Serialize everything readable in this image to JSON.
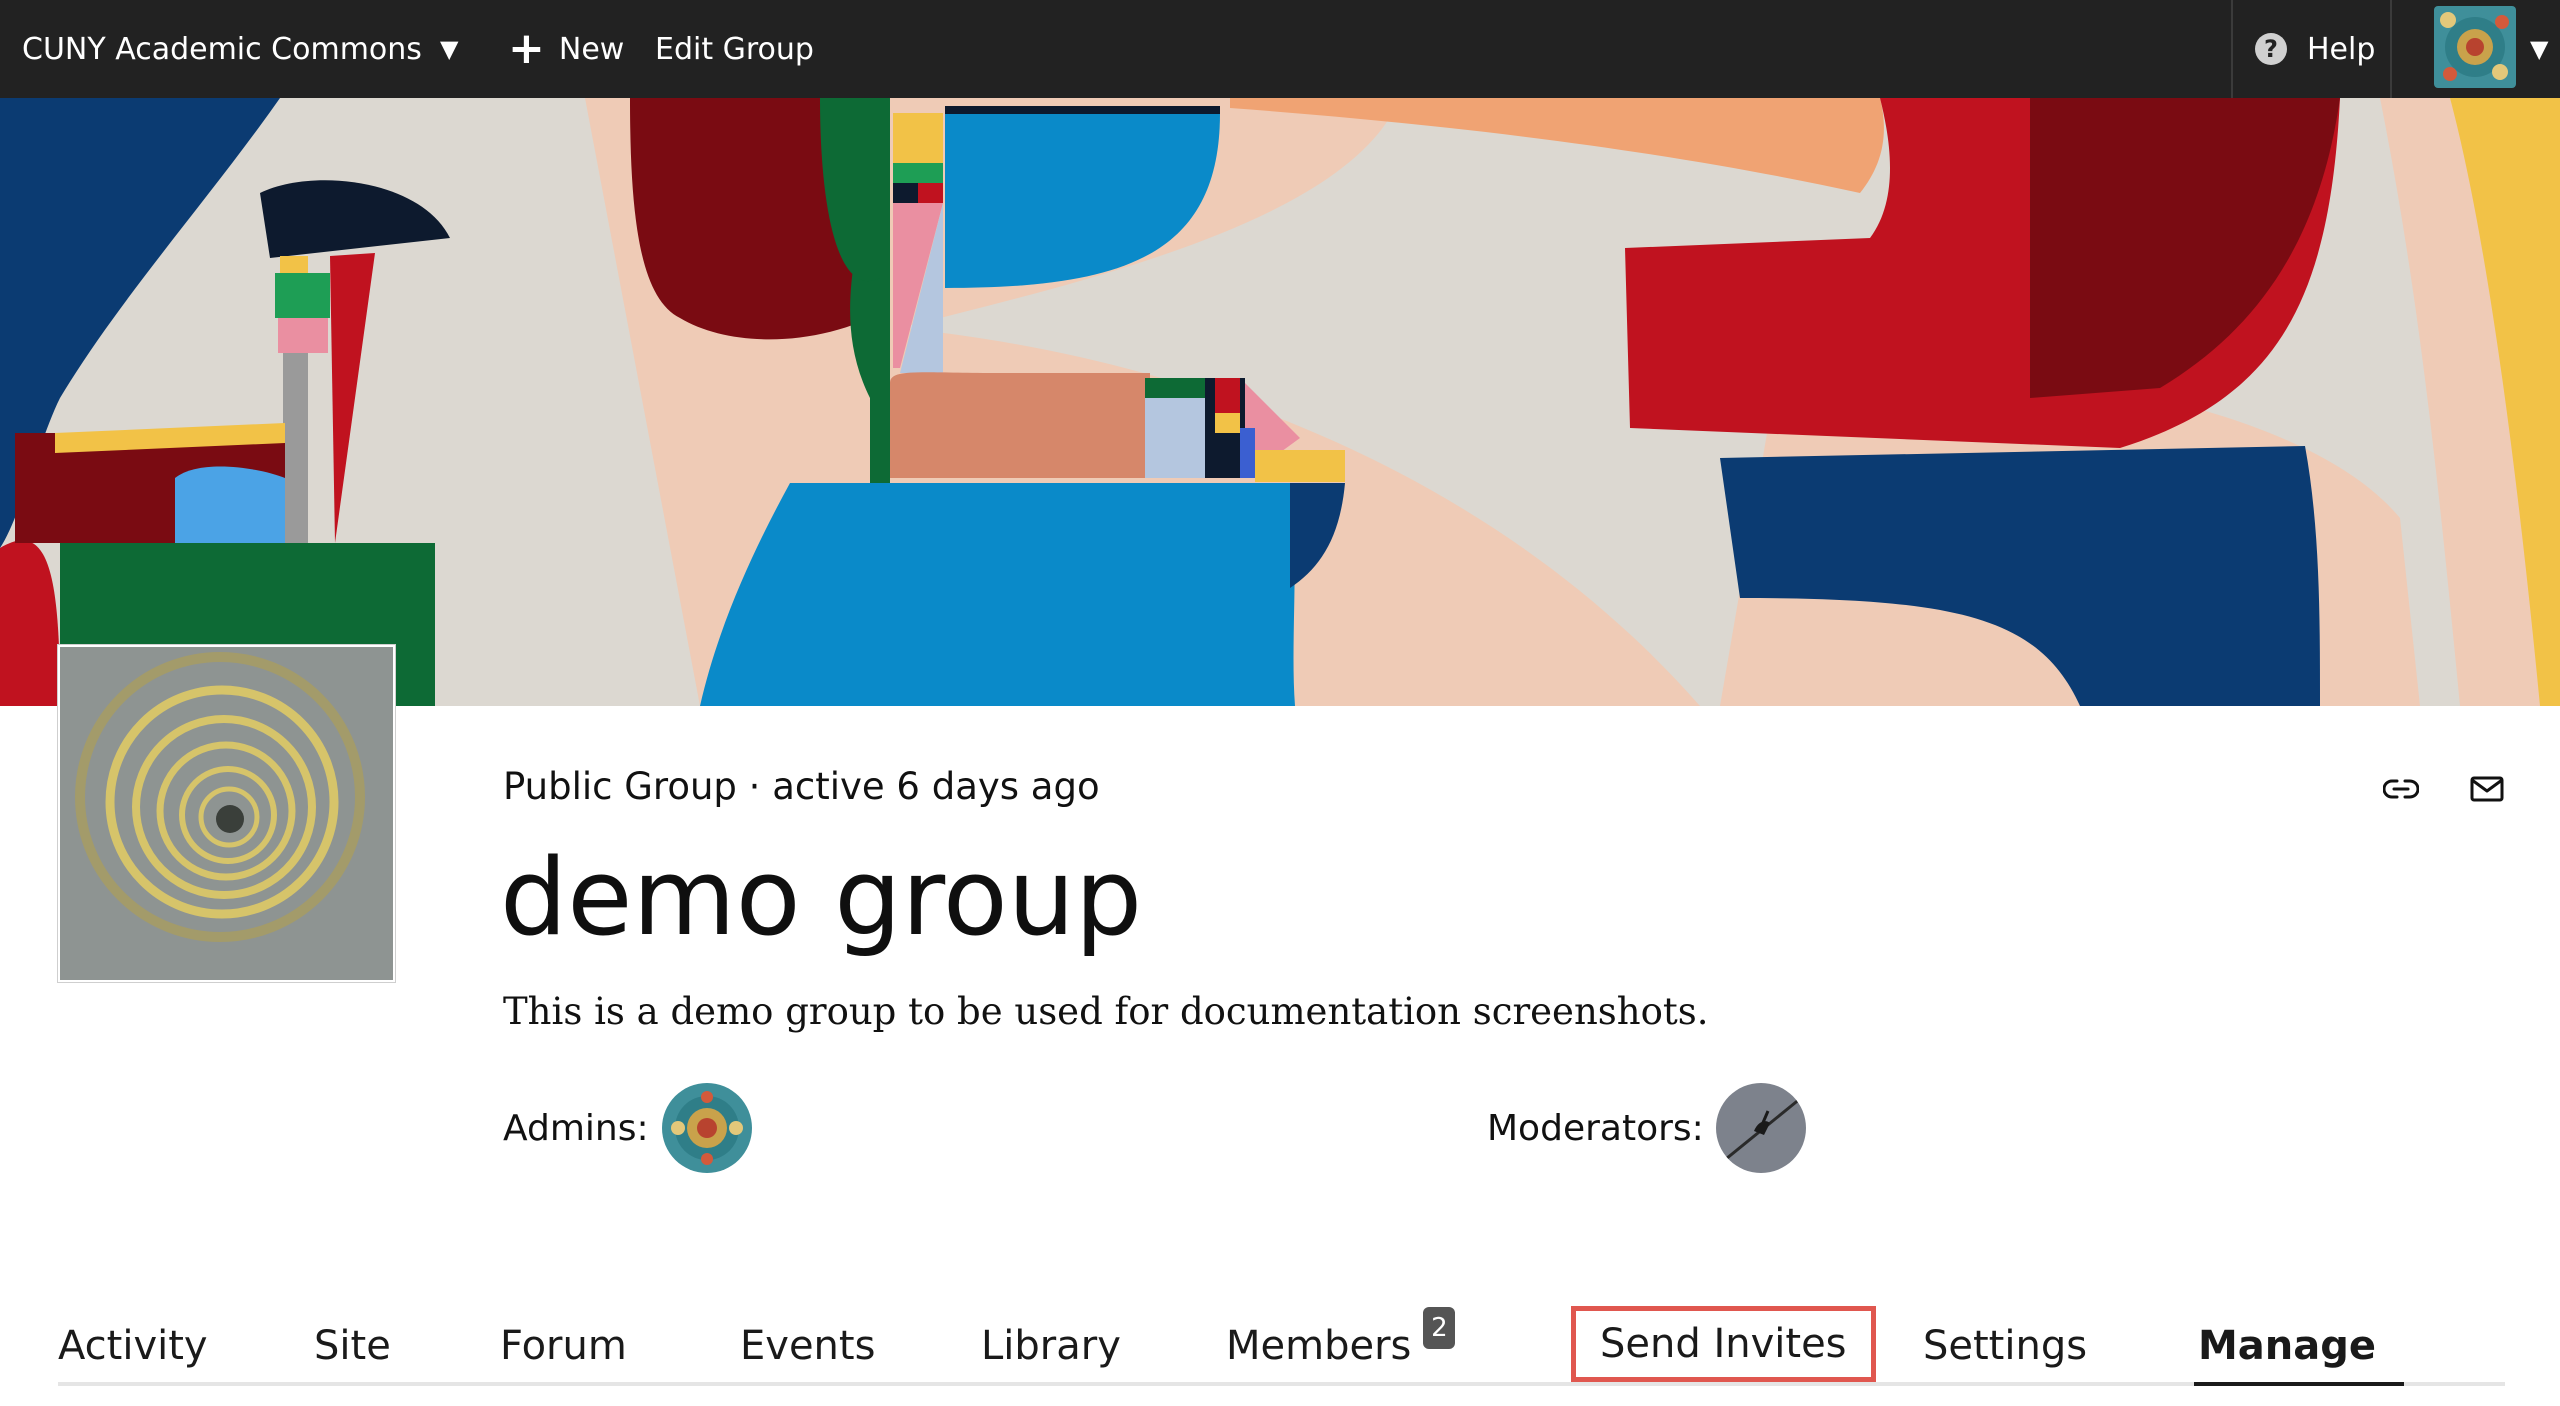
{
  "topbar": {
    "site_name": "CUNY Academic Commons",
    "site_caret": "▼",
    "new_label": "New",
    "new_plus": "+",
    "edit_group_label": "Edit Group",
    "help_label": "Help",
    "help_glyph": "?",
    "account_caret": "▼"
  },
  "group": {
    "meta": "Public Group · active 6 days ago",
    "title": "demo group",
    "description": "This is a demo group to be used for documentation screenshots.",
    "admins_label": "Admins:",
    "moderators_label": "Moderators:"
  },
  "icons": {
    "copy_link": "link-icon",
    "email": "envelope-icon",
    "help": "question-circle-icon",
    "new": "plus-icon"
  },
  "tabs": [
    {
      "label": "Activity"
    },
    {
      "label": "Site"
    },
    {
      "label": "Forum"
    },
    {
      "label": "Events"
    },
    {
      "label": "Library"
    },
    {
      "label": "Members",
      "badge": "2"
    },
    {
      "label": "Send Invites",
      "highlighted": true
    },
    {
      "label": "Settings"
    },
    {
      "label": "Manage",
      "active": true
    }
  ],
  "colors": {
    "topbar_bg": "#222222",
    "highlight_border": "#e0574f",
    "badge_bg": "#555555",
    "tab_underline": "#e5e5e5"
  }
}
